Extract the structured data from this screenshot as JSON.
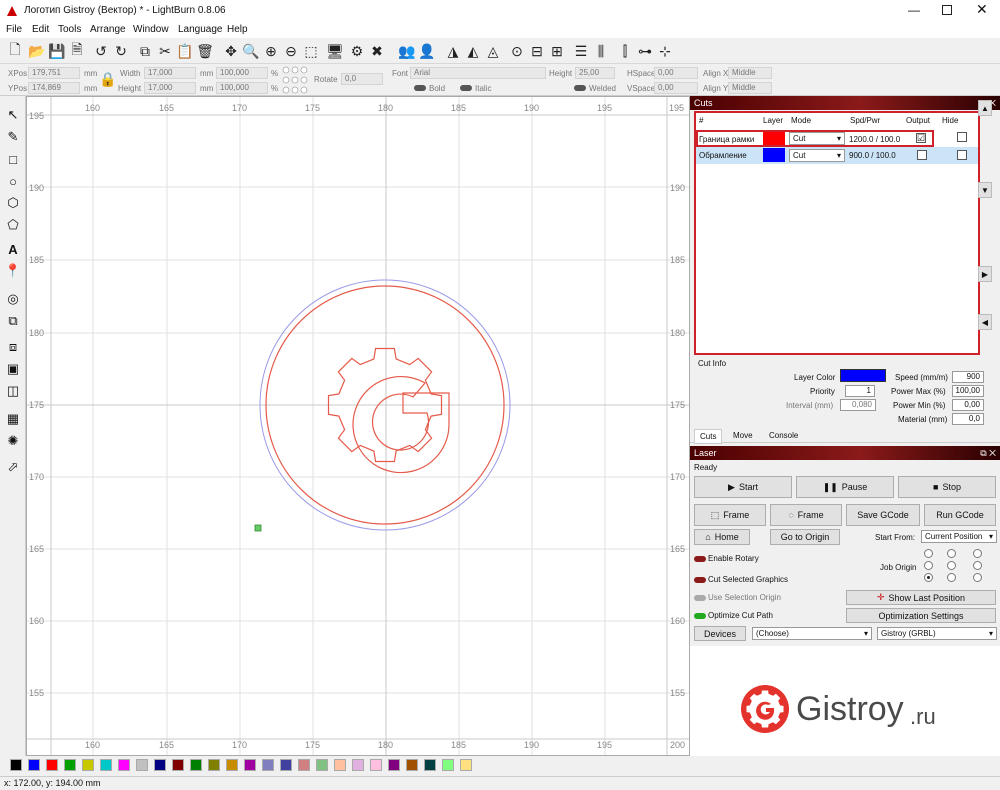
{
  "window": {
    "title": "Логотип Gistroy (Вектор) * - LightBurn 0.8.06"
  },
  "menu": [
    "File",
    "Edit",
    "Tools",
    "Arrange",
    "Window",
    "Language",
    "Help"
  ],
  "props": {
    "xpos_label": "XPos",
    "xpos": "179,751",
    "ypos_label": "YPos",
    "ypos": "174,869",
    "unit": "mm",
    "width_label": "Width",
    "width": "17,000",
    "height_label": "Height",
    "height": "17,000",
    "scale_w": "100,000",
    "scale_h": "100,000",
    "pct": "%",
    "rotate_label": "Rotate",
    "rotate": "0,0",
    "font_label": "Font",
    "font": "Arial",
    "fheight_label": "Height",
    "fheight": "25,00",
    "hspace_label": "HSpace",
    "hspace": "0,00",
    "vspace_label": "VSpace",
    "vspace": "0,00",
    "alignx_label": "Align X",
    "alignx": "Middle",
    "aligny_label": "Align Y",
    "aligny": "Middle",
    "bold": "Bold",
    "italic": "Italic",
    "welded": "Welded"
  },
  "ruler": {
    "top": [
      "160",
      "165",
      "170",
      "175",
      "180",
      "185",
      "190",
      "195",
      "200"
    ],
    "side": [
      "195",
      "190",
      "185",
      "180",
      "175",
      "170",
      "165",
      "160",
      "155"
    ],
    "top_right": "195"
  },
  "cuts": {
    "title": "Cuts",
    "headers": [
      "#",
      "Layer",
      "Mode",
      "Spd/Pwr",
      "Output",
      "Hide"
    ],
    "rows": [
      {
        "name": "Граница рамки",
        "color": "#ff0000",
        "mode": "Cut",
        "spd": "1200.0 / 100.0",
        "output": "☑"
      },
      {
        "name": "Обрамление",
        "color": "#0000ff",
        "mode": "Cut",
        "spd": "900.0 / 100.0",
        "output": ""
      }
    ]
  },
  "cutinfo": {
    "title": "Cut Info",
    "layer_color_label": "Layer Color",
    "layer_color": "#0000ff",
    "speed_label": "Speed (mm/m)",
    "speed": "900",
    "priority_label": "Priority",
    "priority": "1",
    "pmax_label": "Power Max (%)",
    "pmax": "100,00",
    "interval_label": "Interval (mm)",
    "interval": "0,080",
    "pmin_label": "Power Min (%)",
    "pmin": "0,00",
    "material_label": "Material (mm)",
    "material": "0,0"
  },
  "tabs": [
    "Cuts",
    "Move",
    "Console"
  ],
  "laser": {
    "title": "Laser",
    "status": "Ready",
    "start": "Start",
    "pause": "Pause",
    "stop": "Stop",
    "frame1": "Frame",
    "frame2": "Frame",
    "save_gcode": "Save GCode",
    "run_gcode": "Run GCode",
    "home": "Home",
    "go_origin": "Go to Origin",
    "start_from_label": "Start From:",
    "start_from": "Current Position",
    "enable_rotary": "Enable Rotary",
    "job_origin": "Job Origin",
    "cut_selected": "Cut Selected Graphics",
    "use_sel_origin": "Use Selection Origin",
    "show_last": "Show Last Position",
    "optimize": "Optimize Cut Path",
    "opt_settings": "Optimization Settings",
    "devices": "Devices",
    "device_sel": "(Choose)",
    "profile": "Gistroy (GRBL)"
  },
  "watermark": {
    "text": "Gistroy",
    "suffix": ".ru",
    "color": "#e4332c"
  },
  "status": "x: 172.00, y: 194.00 mm",
  "palette": [
    "#000000",
    "#0000ff",
    "#ff0000",
    "#00a000",
    "#c8c800",
    "#00c8c8",
    "#ff00ff",
    "#c0c0c0",
    "#000080",
    "#800000",
    "#008000",
    "#808000",
    "#c88c00",
    "#a000a0",
    "#7f7fbf",
    "#4040a0",
    "#d08080",
    "#80c080",
    "#ffc0a0",
    "#e0b0e0",
    "#ffc0e0",
    "#800080",
    "#a05000",
    "#004040",
    "#80ff80",
    "#ffe080"
  ]
}
